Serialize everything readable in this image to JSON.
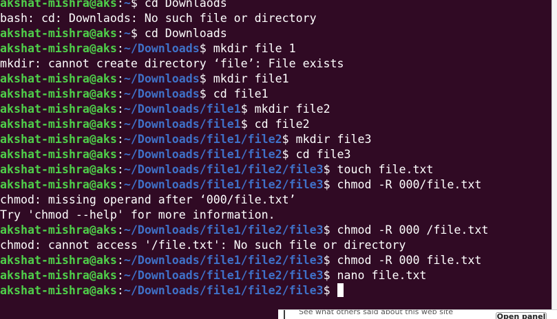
{
  "terminal": {
    "user_host": "akshat-mishra@aks",
    "colors": {
      "background": "#300a24",
      "user_host": "#4fd04a",
      "path": "#3f71c8",
      "text": "#ffffff"
    },
    "lines": [
      {
        "kind": "prompt",
        "path": "~",
        "command": "cd Downlaods"
      },
      {
        "kind": "output",
        "text": "bash: cd: Downlaods: No such file or directory"
      },
      {
        "kind": "prompt",
        "path": "~",
        "command": "cd Downloads"
      },
      {
        "kind": "prompt",
        "path": "~/Downloads",
        "command": "mkdir file 1"
      },
      {
        "kind": "output",
        "text": "mkdir: cannot create directory ‘file’: File exists"
      },
      {
        "kind": "prompt",
        "path": "~/Downloads",
        "command": "mkdir file1"
      },
      {
        "kind": "prompt",
        "path": "~/Downloads",
        "command": "cd file1"
      },
      {
        "kind": "prompt",
        "path": "~/Downloads/file1",
        "command": "mkdir file2"
      },
      {
        "kind": "prompt",
        "path": "~/Downloads/file1",
        "command": "cd file2"
      },
      {
        "kind": "prompt",
        "path": "~/Downloads/file1/file2",
        "command": "mkdir file3"
      },
      {
        "kind": "prompt",
        "path": "~/Downloads/file1/file2",
        "command": "cd file3"
      },
      {
        "kind": "prompt",
        "path": "~/Downloads/file1/file2/file3",
        "command": "touch file.txt"
      },
      {
        "kind": "prompt",
        "path": "~/Downloads/file1/file2/file3",
        "command": "chmod -R 000/file.txt"
      },
      {
        "kind": "output",
        "text": "chmod: missing operand after ‘000/file.txt’"
      },
      {
        "kind": "output",
        "text": "Try 'chmod --help' for more information."
      },
      {
        "kind": "prompt",
        "path": "~/Downloads/file1/file2/file3",
        "command": "chmod -R 000 /file.txt"
      },
      {
        "kind": "output",
        "text": "chmod: cannot access '/file.txt': No such file or directory"
      },
      {
        "kind": "prompt",
        "path": "~/Downloads/file1/file2/file3",
        "command": "chmod -R 000 file.txt"
      },
      {
        "kind": "prompt",
        "path": "~/Downloads/file1/file2/file3",
        "command": "nano file.txt"
      },
      {
        "kind": "prompt",
        "path": "~/Downloads/file1/file2/file3",
        "command": "",
        "cursor": true
      }
    ]
  },
  "background_window": {
    "fragment_text": "See what others said about this web site",
    "button_label": "Open panel"
  }
}
